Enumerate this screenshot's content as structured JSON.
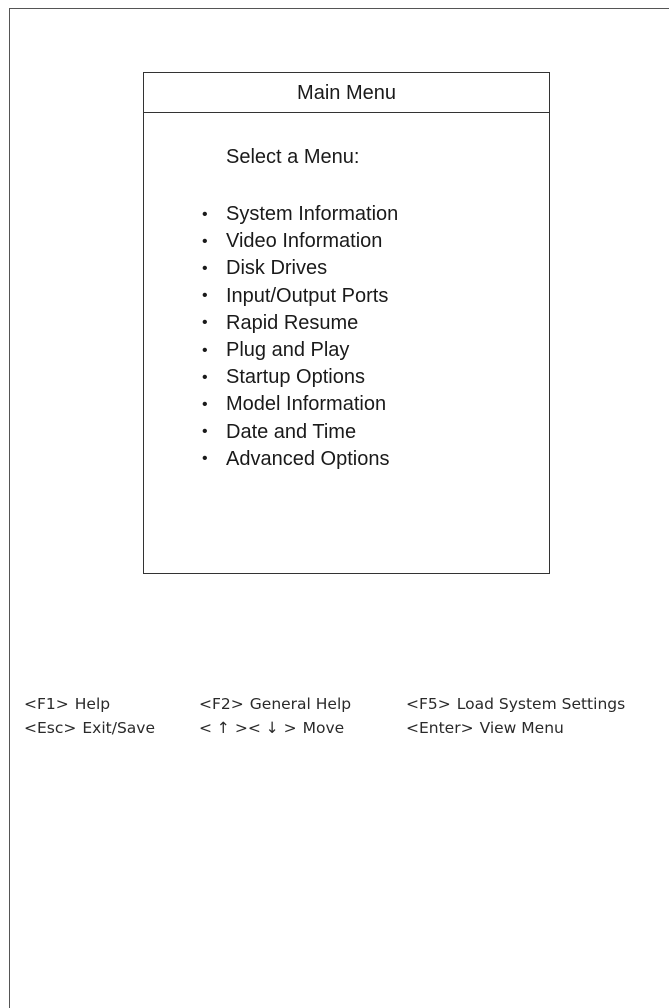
{
  "window": {
    "title": "Main Menu"
  },
  "menu": {
    "prompt": "Select a Menu:",
    "bullet": "•",
    "items": [
      {
        "label": "System Information"
      },
      {
        "label": "Video Information"
      },
      {
        "label": "Disk Drives"
      },
      {
        "label": "Input/Output Ports"
      },
      {
        "label": "Rapid Resume"
      },
      {
        "label": "Plug and Play"
      },
      {
        "label": "Startup Options"
      },
      {
        "label": "Model Information"
      },
      {
        "label": "Date and Time"
      },
      {
        "label": "Advanced Options"
      }
    ]
  },
  "footer": {
    "row1": [
      {
        "key": "<F1>",
        "action": "Help"
      },
      {
        "key": "<F2>",
        "action": "General Help"
      },
      {
        "key": "<F5>",
        "action": "Load System Settings"
      }
    ],
    "row2": [
      {
        "key": "<Esc>",
        "action": "Exit/Save"
      },
      {
        "key": "< ↑ >< ↓ >",
        "action": "Move"
      },
      {
        "key": "<Enter>",
        "action": "View Menu"
      }
    ]
  }
}
